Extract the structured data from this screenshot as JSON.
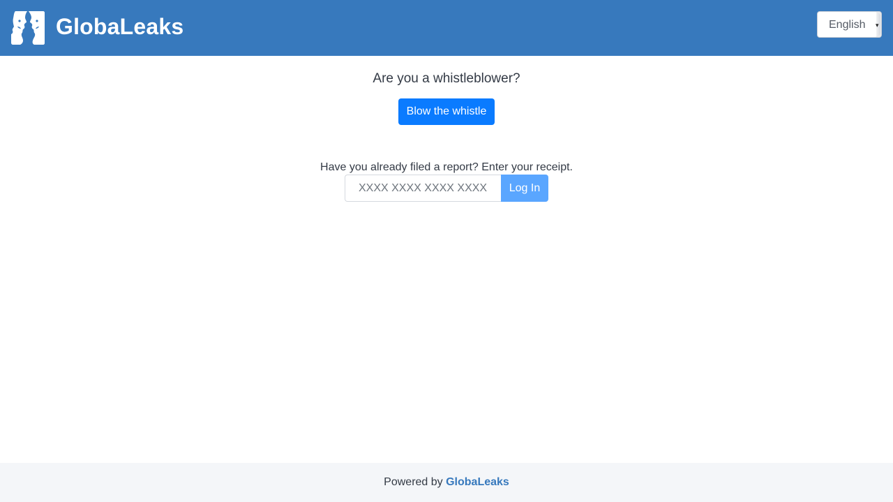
{
  "header": {
    "brand": "GlobaLeaks",
    "logo_icon": "globaleaks-faces-logo",
    "language": {
      "selected": "English"
    },
    "colors": {
      "background": "#3779bd",
      "text": "#ffffff"
    }
  },
  "main": {
    "question": "Are you a whistleblower?",
    "blow_button": "Blow the whistle",
    "receipt_prompt": "Have you already filed a report? Enter your receipt.",
    "receipt_placeholder": "XXXX XXXX XXXX XXXX",
    "login_button": "Log In",
    "colors": {
      "primary_button": "#0a7bff",
      "login_button": "#5aa6ff"
    }
  },
  "footer": {
    "powered_by": "Powered by",
    "link": "GlobaLeaks"
  }
}
